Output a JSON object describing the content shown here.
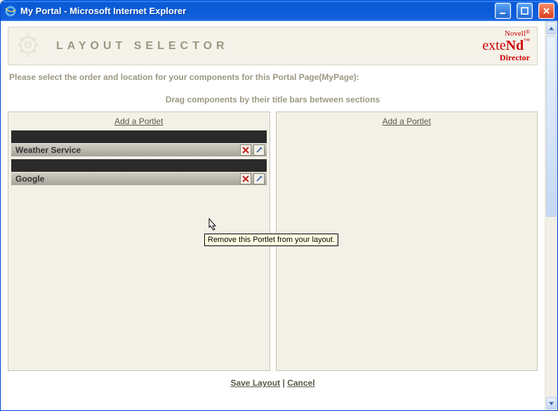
{
  "window": {
    "title": "My Portal - Microsoft Internet Explorer"
  },
  "header": {
    "title": "LAYOUT SELECTOR",
    "brand_line1": "Novell",
    "brand_line2a": "exte",
    "brand_line2b": "Nd",
    "brand_line3": "Director"
  },
  "instructions": {
    "line1": "Please select the order and location for your components for this Portal Page(MyPage):",
    "line2": "Drag components by their title bars between sections"
  },
  "sections": {
    "left": {
      "add_label": "Add a Portlet",
      "portlets": [
        {
          "title": "Weather Service"
        },
        {
          "title": "Google"
        }
      ]
    },
    "right": {
      "add_label": "Add a Portlet"
    }
  },
  "tooltip": "Remove this Portlet from your layout.",
  "footer": {
    "save": "Save Layout",
    "cancel": "Cancel",
    "sep": " | "
  }
}
